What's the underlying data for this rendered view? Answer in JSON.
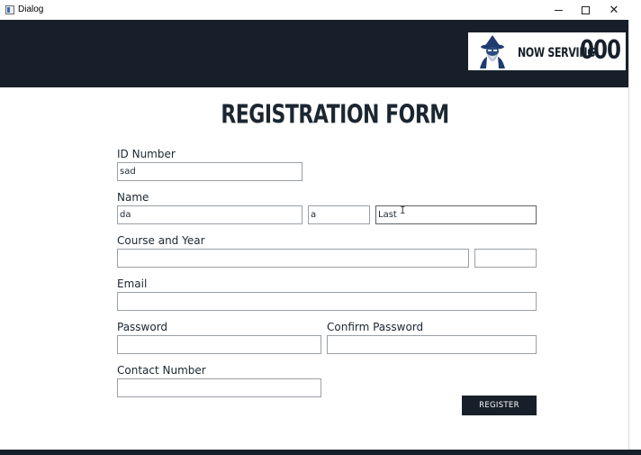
{
  "window": {
    "title": "Dialog",
    "minimize_icon": "minimize-icon",
    "maximize_icon": "maximize-icon",
    "close_icon": "close-icon"
  },
  "header": {
    "serving_label": "NOW SERVING",
    "serving_number": "000",
    "mascot_icon": "wizard-mascot-icon",
    "background_color": "#17202a"
  },
  "form": {
    "title": "REGISTRATION FORM",
    "id_number": {
      "label": "ID Number",
      "value": "sad"
    },
    "name": {
      "label": "Name",
      "first_value": "da",
      "middle_value": "a",
      "last_value": "Last"
    },
    "course_year": {
      "label": "Course and Year",
      "course_value": "",
      "year_value": ""
    },
    "email": {
      "label": "Email",
      "value": ""
    },
    "password": {
      "label": "Password",
      "value": ""
    },
    "confirm_password": {
      "label": "Confirm Password",
      "value": ""
    },
    "contact_number": {
      "label": "Contact Number",
      "value": ""
    },
    "register_label": "REGISTER"
  },
  "colors": {
    "accent_dark": "#17202a",
    "text": "#1b2631"
  }
}
